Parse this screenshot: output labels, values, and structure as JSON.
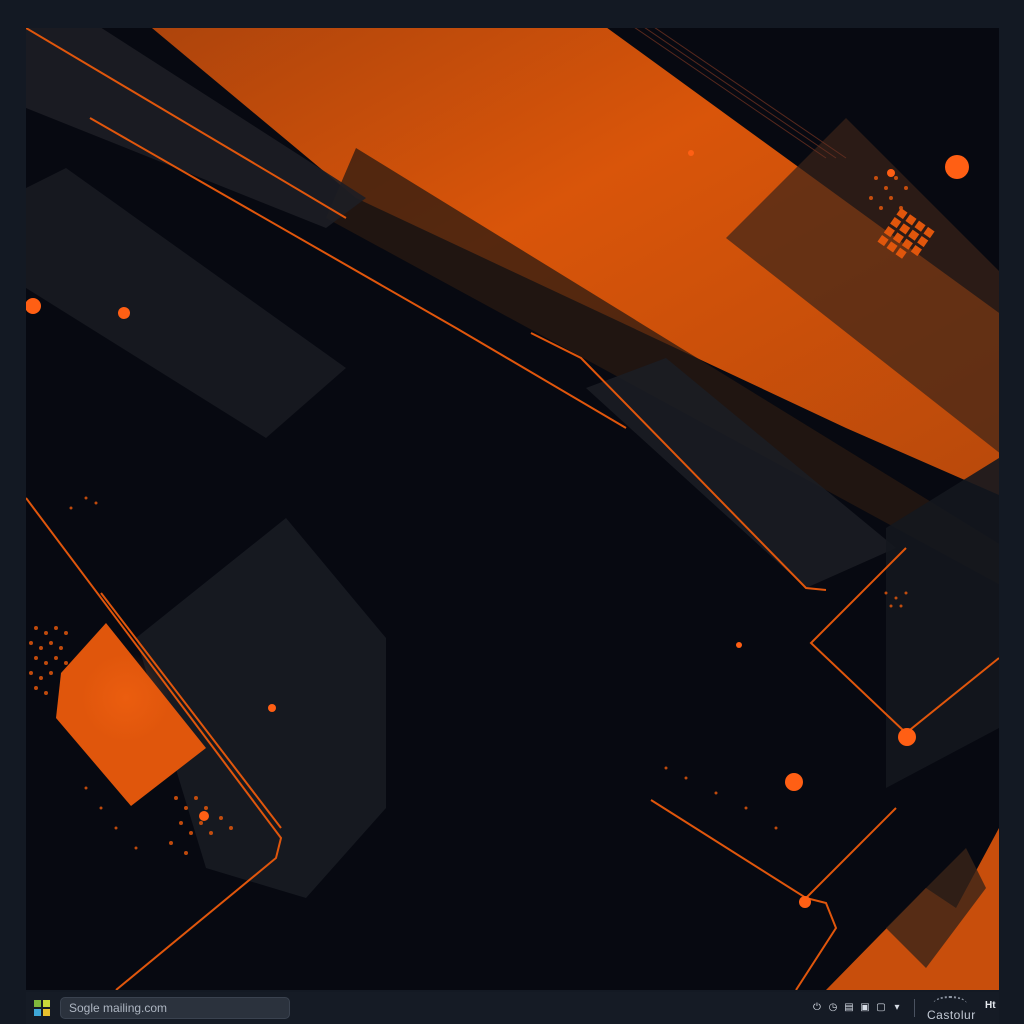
{
  "desktop": {
    "wallpaper": "abstract-geometric-orange-dark",
    "accent_color": "#e0560c",
    "background_color": "#070911"
  },
  "taskbar": {
    "start_icon": "windows-logo-icon",
    "search": {
      "value": "Sogle mailing.com"
    },
    "tray": {
      "icons": [
        "power-icon",
        "clock-icon",
        "document-icon",
        "window-icon",
        "window-icon",
        "chevron-down-icon"
      ],
      "brand_text": "Castolur",
      "label": "Ht"
    }
  }
}
